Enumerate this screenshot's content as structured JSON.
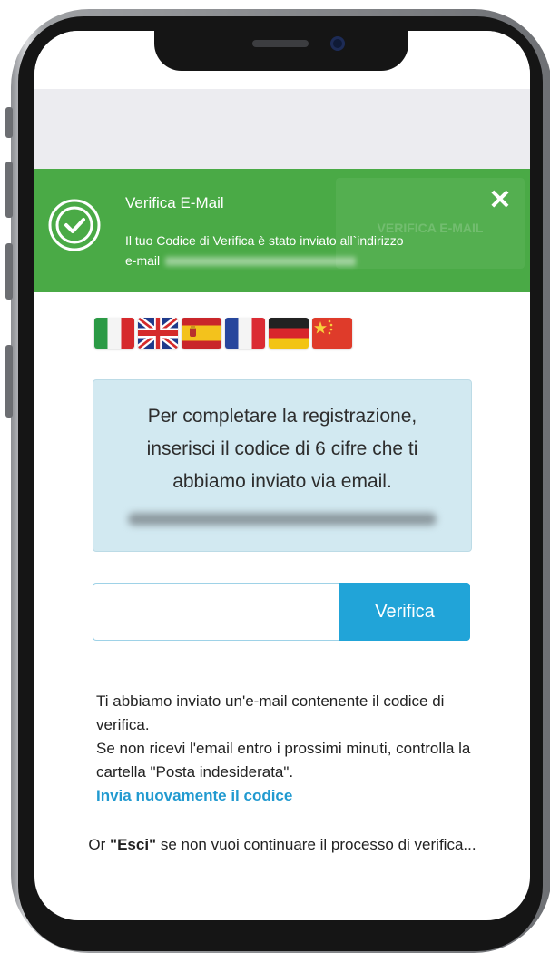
{
  "banner": {
    "title": "Verifica E-Mail",
    "message_line1": "Il tuo Codice di Verifica è stato inviato all`indirizzo",
    "message_line2": "e-mail",
    "close_icon": "✕",
    "ghost_button": "VERIFICA E-MAIL"
  },
  "flags": [
    "italy-flag-icon",
    "uk-flag-icon",
    "spain-flag-icon",
    "france-flag-icon",
    "germany-flag-icon",
    "china-flag-icon"
  ],
  "info": {
    "text": "Per completare la registrazione, inserisci il codice di 6 cifre che ti abbiamo inviato via email."
  },
  "form": {
    "code_value": "",
    "verify_label": "Verifica"
  },
  "instructions": {
    "line1": "Ti abbiamo inviato un'e-mail contenente il codice di verifica.",
    "line2": "Se non ricevi l'email entro i prossimi minuti, controlla la cartella \"Posta indesiderata\".",
    "resend_label": "Invia nuovamente il codice"
  },
  "exit": {
    "prefix": "Or ",
    "keyword": "\"Esci\"",
    "suffix": " se non vuoi continuare il processo di verifica..."
  },
  "colors": {
    "banner_green": "#4aaa46",
    "button_blue": "#21a4d8",
    "link_blue": "#219ad0",
    "info_box": "#d2e9f1"
  }
}
